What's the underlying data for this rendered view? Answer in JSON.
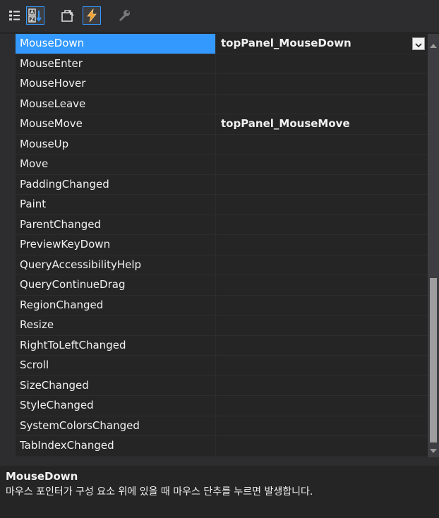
{
  "toolbar": {
    "buttons": [
      {
        "name": "categorized-icon",
        "checked": false
      },
      {
        "name": "alphabetical-icon",
        "checked": true
      },
      {
        "name": "properties-icon",
        "checked": false
      },
      {
        "name": "events-icon",
        "checked": true
      },
      {
        "name": "property-pages-icon",
        "checked": false
      }
    ]
  },
  "events": [
    {
      "name": "MouseDown",
      "value": "topPanel_MouseDown",
      "selected": true
    },
    {
      "name": "MouseEnter",
      "value": ""
    },
    {
      "name": "MouseHover",
      "value": ""
    },
    {
      "name": "MouseLeave",
      "value": ""
    },
    {
      "name": "MouseMove",
      "value": "topPanel_MouseMove"
    },
    {
      "name": "MouseUp",
      "value": ""
    },
    {
      "name": "Move",
      "value": ""
    },
    {
      "name": "PaddingChanged",
      "value": ""
    },
    {
      "name": "Paint",
      "value": ""
    },
    {
      "name": "ParentChanged",
      "value": ""
    },
    {
      "name": "PreviewKeyDown",
      "value": ""
    },
    {
      "name": "QueryAccessibilityHelp",
      "value": ""
    },
    {
      "name": "QueryContinueDrag",
      "value": ""
    },
    {
      "name": "RegionChanged",
      "value": ""
    },
    {
      "name": "Resize",
      "value": ""
    },
    {
      "name": "RightToLeftChanged",
      "value": ""
    },
    {
      "name": "Scroll",
      "value": ""
    },
    {
      "name": "SizeChanged",
      "value": ""
    },
    {
      "name": "StyleChanged",
      "value": ""
    },
    {
      "name": "SystemColorsChanged",
      "value": ""
    },
    {
      "name": "TabIndexChanged",
      "value": ""
    }
  ],
  "description": {
    "title": "MouseDown",
    "text": "마우스 포인터가 구성 요소 위에 있을 때 마우스 단추를 누르면 발생합니다."
  },
  "colors": {
    "background": "#252526",
    "toolbar": "#2d2d30",
    "selection": "#3399ff",
    "text": "#f1f1f1",
    "scroll_thumb": "#9e9e9e"
  }
}
